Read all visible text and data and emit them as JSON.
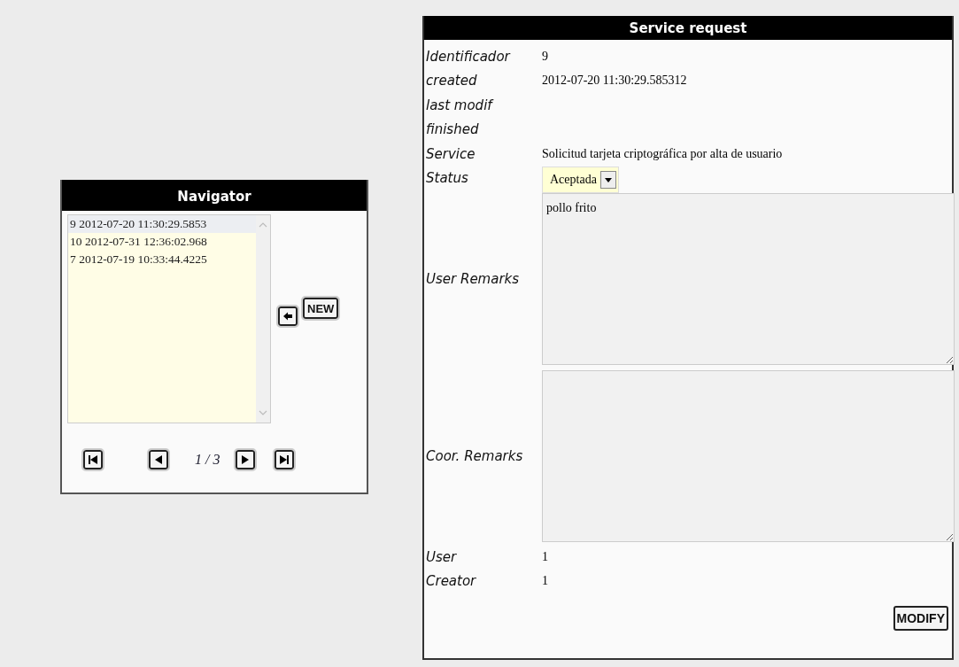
{
  "navigator": {
    "title": "Navigator",
    "items": [
      {
        "label": "9 2012-07-20 11:30:29.5853",
        "selected": true
      },
      {
        "label": "10 2012-07-31 12:36:02.968",
        "selected": false
      },
      {
        "label": "7 2012-07-19 10:33:44.4225",
        "selected": false
      }
    ],
    "new_button": "NEW",
    "page": "1 / 3"
  },
  "service_request": {
    "title": "Service request",
    "fields": [
      {
        "label": "Identificador",
        "kind": "text",
        "value": "9"
      },
      {
        "label": "created",
        "kind": "text",
        "value": "2012-07-20 11:30:29.585312"
      },
      {
        "label": "last modif",
        "kind": "text"
      },
      {
        "label": "finished",
        "kind": "text"
      },
      {
        "label": "Service",
        "kind": "text",
        "value": "Solicitud tarjeta criptográfica por alta de usuario"
      },
      {
        "label": "Status",
        "kind": "select",
        "value": "Aceptada"
      },
      {
        "label": "User Remarks",
        "kind": "textarea",
        "value": "pollo frito"
      },
      {
        "label": "Coor. Remarks",
        "kind": "textarea"
      },
      {
        "label": "User",
        "kind": "text",
        "value": "1"
      },
      {
        "label": "Creator",
        "kind": "text",
        "value": "1"
      }
    ],
    "modify_button": "MODIFY"
  }
}
